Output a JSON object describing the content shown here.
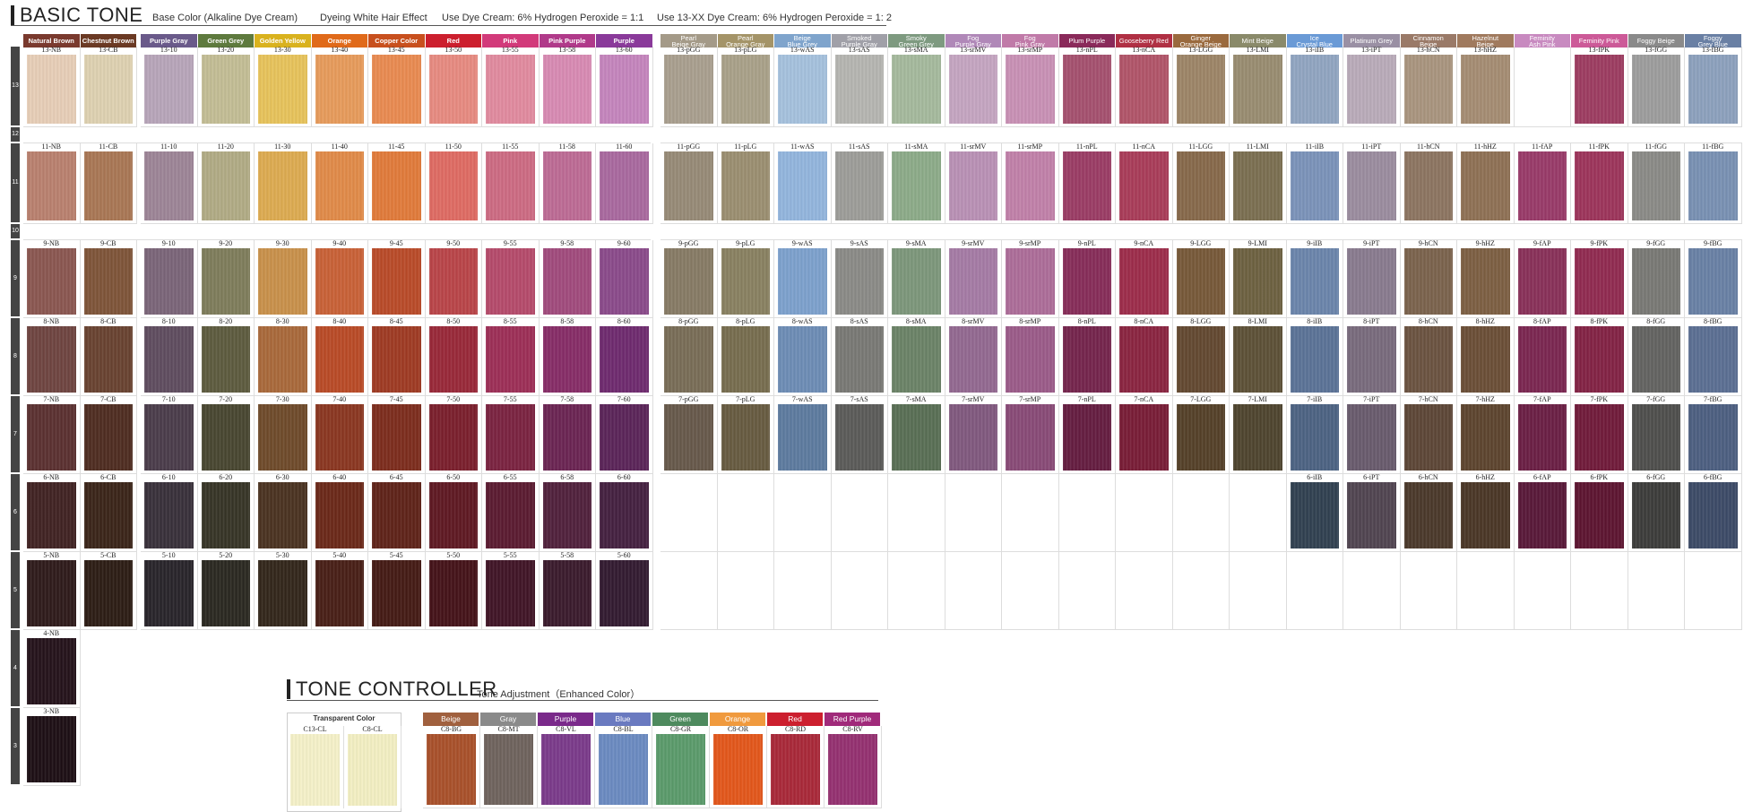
{
  "header": {
    "title": "BASIC TONE",
    "info": [
      "Base Color (Alkaline Dye Cream)",
      "Dyeing White Hair Effect",
      "Use Dye Cream: 6% Hydrogen Peroxide = 1:1",
      "Use 13-XX Dye Cream: 6% Hydrogen Peroxide = 1: 2"
    ]
  },
  "levels": [
    "13",
    "12",
    "11",
    "10",
    "9",
    "8",
    "7",
    "6",
    "5",
    "4",
    "3"
  ],
  "left_columns": [
    {
      "label": "Natural Brown",
      "color": "#7a3a2e",
      "prefix": "NB"
    },
    {
      "label": "Chestnut Brown",
      "color": "#6b3a24",
      "prefix": "CB"
    },
    {
      "label": "Purple Gray",
      "color": "#6a5a8a",
      "prefix": "10"
    },
    {
      "label": "Green Grey",
      "color": "#5e7a3e",
      "prefix": "20"
    },
    {
      "label": "Golden Yellow",
      "color": "#d9b21e",
      "prefix": "30"
    },
    {
      "label": "Orange",
      "color": "#e06a1a",
      "prefix": "40"
    },
    {
      "label": "Copper Color",
      "color": "#c8501e",
      "prefix": "45"
    },
    {
      "label": "Red",
      "color": "#cc1f2e",
      "prefix": "50"
    },
    {
      "label": "Pink",
      "color": "#d23a7a",
      "prefix": "55"
    },
    {
      "label": "Pink Purple",
      "color": "#b03a8a",
      "prefix": "58"
    },
    {
      "label": "Purple",
      "color": "#8a3a9a",
      "prefix": "60"
    }
  ],
  "left_codes": {
    "13": [
      "13-NB",
      "13-CB",
      "13-10",
      "13-20",
      "13-30",
      "13-40",
      "13-45",
      "13-50",
      "13-55",
      "13-58",
      "13-60"
    ],
    "11": [
      "11-NB",
      "11-CB",
      "11-10",
      "11-20",
      "11-30",
      "11-40",
      "11-45",
      "11-50",
      "11-55",
      "11-58",
      "11-60"
    ],
    "9": [
      "9-NB",
      "9-CB",
      "9-10",
      "9-20",
      "9-30",
      "9-40",
      "9-45",
      "9-50",
      "9-55",
      "9-58",
      "9-60"
    ],
    "8": [
      "8-NB",
      "8-CB",
      "8-10",
      "8-20",
      "8-30",
      "8-40",
      "8-45",
      "8-50",
      "8-55",
      "8-58",
      "8-60"
    ],
    "7": [
      "7-NB",
      "7-CB",
      "7-10",
      "7-20",
      "7-30",
      "7-40",
      "7-45",
      "7-50",
      "7-55",
      "7-58",
      "7-60"
    ],
    "6": [
      "6-NB",
      "6-CB",
      "6-10",
      "6-20",
      "6-30",
      "6-40",
      "6-45",
      "6-50",
      "6-55",
      "6-58",
      "6-60"
    ],
    "5": [
      "5-NB",
      "5-CB",
      "5-10",
      "5-20",
      "5-30",
      "5-40",
      "5-45",
      "5-50",
      "5-55",
      "5-58",
      "5-60"
    ],
    "4": [
      "4-NB"
    ],
    "3": [
      "3-NB"
    ]
  },
  "left_swatch_colors": {
    "13": [
      "#e6cdb6",
      "#ddd0b0",
      "#b6a4b8",
      "#c2bc94",
      "#e6c25a",
      "#e69a5a",
      "#e88a50",
      "#e68a80",
      "#e08a9e",
      "#d78ab2",
      "#c484bc"
    ],
    "11": [
      "#b8806e",
      "#a87654",
      "#9c8496",
      "#b0aa84",
      "#dcaa50",
      "#e08a48",
      "#e07a3a",
      "#de6a62",
      "#cc6a82",
      "#bc6a94",
      "#a8689e"
    ],
    "9": [
      "#8a5650",
      "#7e5438",
      "#7a6478",
      "#7e7c5a",
      "#c8904a",
      "#c86036",
      "#b84a28",
      "#b84448",
      "#b44a6a",
      "#a04a7c",
      "#8a4a8a"
    ],
    "8": [
      "#6e4440",
      "#684230",
      "#5e4c5e",
      "#5c5a3e",
      "#a8683a",
      "#b84a26",
      "#9e3a22",
      "#982838",
      "#9c2e56",
      "#862c66",
      "#6e2a6e"
    ],
    "7": [
      "#5a3030",
      "#4e2c20",
      "#4a3c4a",
      "#484630",
      "#6e4a2a",
      "#8a3620",
      "#7c2c1c",
      "#7a1e2c",
      "#7a2240",
      "#6a2452",
      "#5a2458"
    ],
    "6": [
      "#402222",
      "#3a2418",
      "#38303a",
      "#363426",
      "#4a3220",
      "#6a2818",
      "#5e2218",
      "#5e1822",
      "#5a1a30",
      "#50203c",
      "#442040"
    ],
    "5": [
      "#2e1a1a",
      "#2c1c14",
      "#28242a",
      "#2a2820",
      "#32261a",
      "#481e16",
      "#441a14",
      "#441218",
      "#401426",
      "#3a1a2c",
      "#321a30"
    ],
    "4": [
      "#24121a"
    ],
    "3": [
      "#1c0e14"
    ]
  },
  "right_columns": [
    {
      "label": "Pearl\nBeige Gray",
      "color": "#a49a88",
      "suffix": "pGG"
    },
    {
      "label": "Pearl\nOrange Gray",
      "color": "#a49468",
      "suffix": "pLG"
    },
    {
      "label": "Beige\nBlue Grey",
      "color": "#7fa4cc",
      "suffix": "wAS"
    },
    {
      "label": "Smoked\nPurple Gray",
      "color": "#a0a0a8",
      "suffix": "sAS"
    },
    {
      "label": "Smoky\nGreen Grey",
      "color": "#7e9a80",
      "suffix": "sMA"
    },
    {
      "label": "Fog\nPurple Gray",
      "color": "#b088b8",
      "suffix": "srMV"
    },
    {
      "label": "Fog\nPink Gray",
      "color": "#c07aa8",
      "suffix": "srMP"
    },
    {
      "label": "Plum Purple",
      "color": "#8a2a5a",
      "suffix": "nPL"
    },
    {
      "label": "Gooseberry Red",
      "color": "#b03044",
      "suffix": "nCA"
    },
    {
      "label": "Ginger\nOrange Beige",
      "color": "#9a6a3e",
      "suffix": "LGG"
    },
    {
      "label": "Mint Beige",
      "color": "#8a8a6a",
      "suffix": "LMI"
    },
    {
      "label": "Ice\nCrystal Blue",
      "color": "#6a9ad6",
      "suffix": "iIB"
    },
    {
      "label": "Platinum Grey",
      "color": "#9a90a4",
      "suffix": "iPT"
    },
    {
      "label": "Cinnamon\nBeige",
      "color": "#9a7a68",
      "suffix": "hCN"
    },
    {
      "label": "Hazelnut\nBeige",
      "color": "#a07a5e",
      "suffix": "hHZ"
    },
    {
      "label": "Feminity\nAsh Pink",
      "color": "#c88ac0",
      "suffix": "fAP"
    },
    {
      "label": "Feminity Pink",
      "color": "#cc5a98",
      "suffix": "fPK"
    },
    {
      "label": "Foggy Beige",
      "color": "#8a8a8a",
      "suffix": "fGG"
    },
    {
      "label": "Foggy\nGrey Blue",
      "color": "#6a80a4",
      "suffix": "fBG"
    }
  ],
  "right_levels": [
    "13",
    "11",
    "9",
    "8",
    "7",
    "6"
  ],
  "right_codes": {
    "13": [
      "13-pGG",
      "13-pLG",
      "13-wAS",
      "13-sAS",
      "13-sMA",
      "13-srMV",
      "13-srMP",
      "13-nPL",
      "13-nCA",
      "13-LGG",
      "13-LMI",
      "13-iIB",
      "13-iPT",
      "13-hCN",
      "13-hHZ",
      "",
      "13-fPK",
      "13-fGG",
      "13-fBG"
    ],
    "11": [
      "11-pGG",
      "11-pLG",
      "11-wAS",
      "11-sAS",
      "11-sMA",
      "11-srMV",
      "11-srMP",
      "11-nPL",
      "11-nCA",
      "11-LGG",
      "11-LMI",
      "11-iIB",
      "11-iPT",
      "11-hCN",
      "11-hHZ",
      "11-fAP",
      "11-fPK",
      "11-fGG",
      "11-fBG"
    ],
    "9": [
      "9-pGG",
      "9-pLG",
      "9-wAS",
      "9-sAS",
      "9-sMA",
      "9-srMV",
      "9-srMP",
      "9-nPL",
      "9-nCA",
      "9-LGG",
      "9-LMI",
      "9-iIB",
      "9-iPT",
      "9-hCN",
      "9-hHZ",
      "9-fAP",
      "9-fPK",
      "9-fGG",
      "9-fBG"
    ],
    "8": [
      "8-pGG",
      "8-pLG",
      "8-wAS",
      "8-sAS",
      "8-sMA",
      "8-srMV",
      "8-srMP",
      "8-nPL",
      "8-nCA",
      "8-LGG",
      "8-LMI",
      "8-iIB",
      "8-iPT",
      "8-hCN",
      "8-hHZ",
      "8-fAP",
      "8-fPK",
      "8-fGG",
      "8-fBG"
    ],
    "7": [
      "7-pGG",
      "7-pLG",
      "7-wAS",
      "7-sAS",
      "7-sMA",
      "7-srMV",
      "7-srMP",
      "7-nPL",
      "7-nCA",
      "7-LGG",
      "7-LMI",
      "7-iIB",
      "7-iPT",
      "7-hCN",
      "7-hHZ",
      "7-fAP",
      "7-fPK",
      "7-fGG",
      "7-fBG"
    ],
    "6": [
      "",
      "",
      "",
      "",
      "",
      "",
      "",
      "",
      "",
      "",
      "",
      "6-iIB",
      "6-iPT",
      "6-hCN",
      "6-hHZ",
      "6-fAP",
      "6-fPK",
      "6-fGG",
      "6-fBG"
    ]
  },
  "right_swatch_colors": {
    "13": [
      "#a89e8e",
      "#a8a088",
      "#a4c0dc",
      "#b4b4b0",
      "#a4b89c",
      "#c4a4c0",
      "#c890b4",
      "#a4506e",
      "#b05468",
      "#9c8466",
      "#988c70",
      "#90a4c0",
      "#b8aab8",
      "#a8947e",
      "#a48c72",
      "",
      "#9c3c60",
      "#9c9c9c",
      "#8ca0bc"
    ],
    "11": [
      "#968a76",
      "#9a8e70",
      "#92b4dc",
      "#9c9c98",
      "#8caa88",
      "#b890b4",
      "#c080a8",
      "#9a3c64",
      "#a83c58",
      "#86684a",
      "#7a6e50",
      "#7a92b8",
      "#9a8c9e",
      "#8c7460",
      "#8e7054",
      "#983a68",
      "#9c345a",
      "#8a8a86",
      "#7890b2"
    ],
    "9": [
      "#867a64",
      "#888060",
      "#7ca0cc",
      "#8a8a86",
      "#7c967a",
      "#a47aa4",
      "#ac6c98",
      "#862c58",
      "#9c2c4a",
      "#765838",
      "#6c6040",
      "#6a84aa",
      "#887a8e",
      "#7a624c",
      "#7c5e42",
      "#883058",
      "#902a50",
      "#787874",
      "#6880a4"
    ],
    "8": [
      "#786c56",
      "#766c4e",
      "#6c8cb4",
      "#787874",
      "#6a8266",
      "#926890",
      "#9a5a88",
      "#74244c",
      "#8a2440",
      "#624830",
      "#5c5036",
      "#5a7296",
      "#786a7c",
      "#6a5240",
      "#6a4e36",
      "#7a2650",
      "#822244",
      "#626260",
      "#5a6e92"
    ],
    "7": [
      "#66584a",
      "#665a40",
      "#5c7a9e",
      "#5a5a58",
      "#586e54",
      "#80587e",
      "#884a76",
      "#641c40",
      "#781c36",
      "#544028",
      "#4e442e",
      "#4c6282",
      "#685a6c",
      "#5c4636",
      "#5c442e",
      "#6a1e44",
      "#701a3a",
      "#4e4e4c",
      "#4c5e80"
    ],
    "6": [
      "",
      "",
      "",
      "",
      "",
      "",
      "",
      "",
      "",
      "",
      "",
      "#304050",
      "#504450",
      "#4a382a",
      "#4a3626",
      "#581838",
      "#5c1430",
      "#3c3c3a",
      "#3c4a66"
    ]
  },
  "tone_controller": {
    "title": "TONE CONTROLLER",
    "subtitle": "Tone Adjustment（Enhanced Color）",
    "transparent_title": "Transparent Color",
    "transparent_codes": [
      "C13-CL",
      "C8-CL"
    ],
    "transparent_colors": [
      "#f4f0c8",
      "#f2eec2"
    ],
    "columns": [
      {
        "label": "Beige",
        "color": "#a0603e",
        "code": "C8-BG",
        "swatch": "#a8502a"
      },
      {
        "label": "Gray",
        "color": "#8a8a8a",
        "code": "C8-MT",
        "swatch": "#6e625c"
      },
      {
        "label": "Purple",
        "color": "#7a2a8a",
        "code": "C8-VL",
        "swatch": "#7a3a8a"
      },
      {
        "label": "Blue",
        "color": "#6a7ac0",
        "code": "C8-BL",
        "swatch": "#6a8ac0"
      },
      {
        "label": "Green",
        "color": "#4e8a5e",
        "code": "C8-GR",
        "swatch": "#5a9a6a"
      },
      {
        "label": "Orange",
        "color": "#f09a3e",
        "code": "C8-OR",
        "swatch": "#e2561a"
      },
      {
        "label": "Red",
        "color": "#cc1f2e",
        "code": "C8-RD",
        "swatch": "#a82838"
      },
      {
        "label": "Red Purple",
        "color": "#a02a7a",
        "code": "C8-RV",
        "swatch": "#943070"
      }
    ]
  }
}
